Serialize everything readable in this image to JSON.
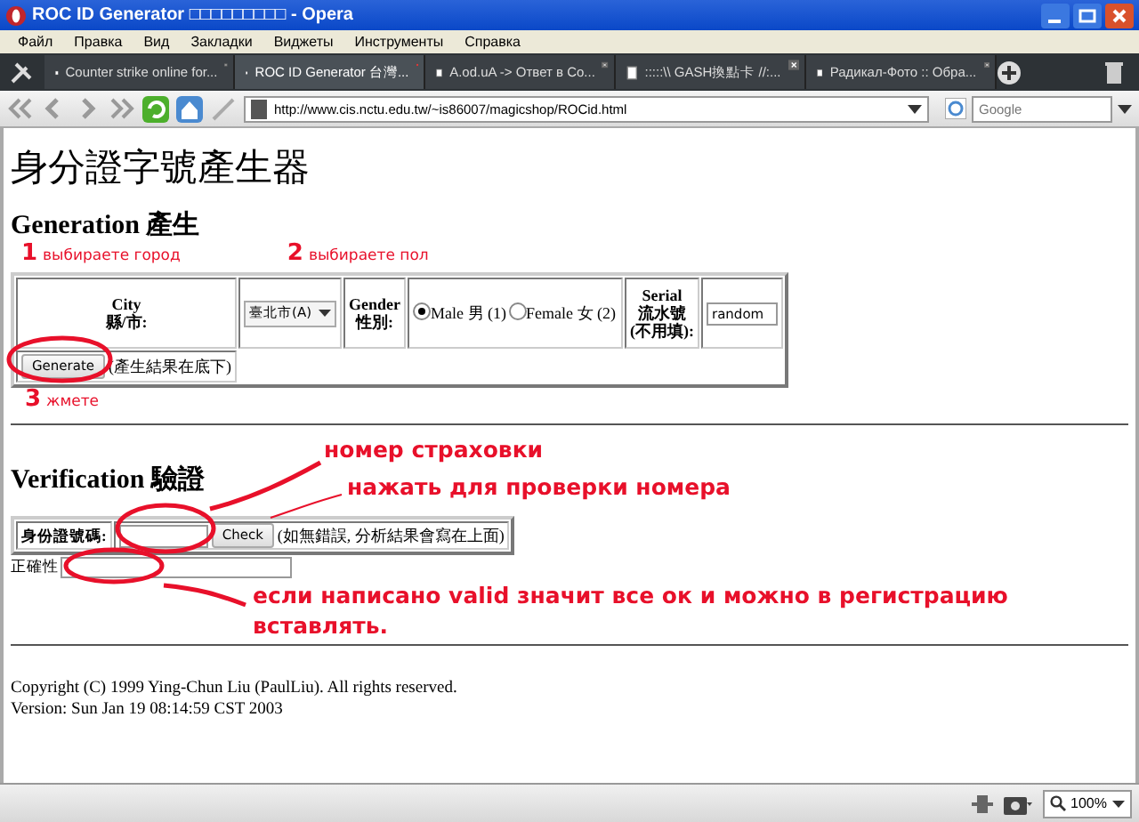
{
  "window": {
    "title": "ROC ID Generator □□□□□□□□□ - Opera"
  },
  "menu": [
    "Файл",
    "Правка",
    "Вид",
    "Закладки",
    "Виджеты",
    "Инструменты",
    "Справка"
  ],
  "tabs": [
    {
      "label": "Counter strike online for...",
      "selected": false
    },
    {
      "label": "ROC ID Generator 台灣...",
      "selected": true
    },
    {
      "label": "A.od.uA -> Ответ в Co...",
      "selected": false
    },
    {
      "label": ":::::\\\\ GASH換點卡 //:...",
      "selected": false
    },
    {
      "label": "Радикал-Фото :: Обра...",
      "selected": false
    }
  ],
  "address_bar": {
    "url": "http://www.cis.nctu.edu.tw/~is86007/magicshop/ROCid.html"
  },
  "search": {
    "placeholder": "Google"
  },
  "page": {
    "heading": "身分證字號產生器",
    "generation": {
      "title": "Generation 產生",
      "city_label": [
        "City",
        "縣/市:"
      ],
      "city_value": "臺北市(A)",
      "gender_label": [
        "Gender",
        "性別:"
      ],
      "gender_options": [
        {
          "label": "Male 男 (1)",
          "selected": true
        },
        {
          "label": "Female 女 (2)",
          "selected": false
        }
      ],
      "serial_label": [
        "Serial",
        "流水號",
        "(不用填):"
      ],
      "serial_value": "random",
      "button": "Generate",
      "note": "(產生結果在底下)"
    },
    "verification": {
      "title": "Verification 驗證",
      "id_label": "身份證號碼:",
      "button": "Check",
      "note": "(如無錯誤, 分析結果會寫在上面)",
      "validity_label": "正確性"
    },
    "footer": [
      "Copyright (C) 1999 Ying-Chun Liu (PaulLiu). All rights reserved.",
      "Version: Sun Jan 19 08:14:59 CST 2003"
    ]
  },
  "annotations": [
    {
      "number": "1",
      "text": "выбираете город"
    },
    {
      "number": "2",
      "text": "выбираете пол"
    },
    {
      "number": "3",
      "text": "жмете"
    },
    {
      "text": "номер страховки"
    },
    {
      "text": "нажать для проверки номера"
    },
    {
      "text": "если написано valid значит все ок и можно в регистрацию вставлять."
    }
  ],
  "status_bar": {
    "zoom": "100%"
  }
}
